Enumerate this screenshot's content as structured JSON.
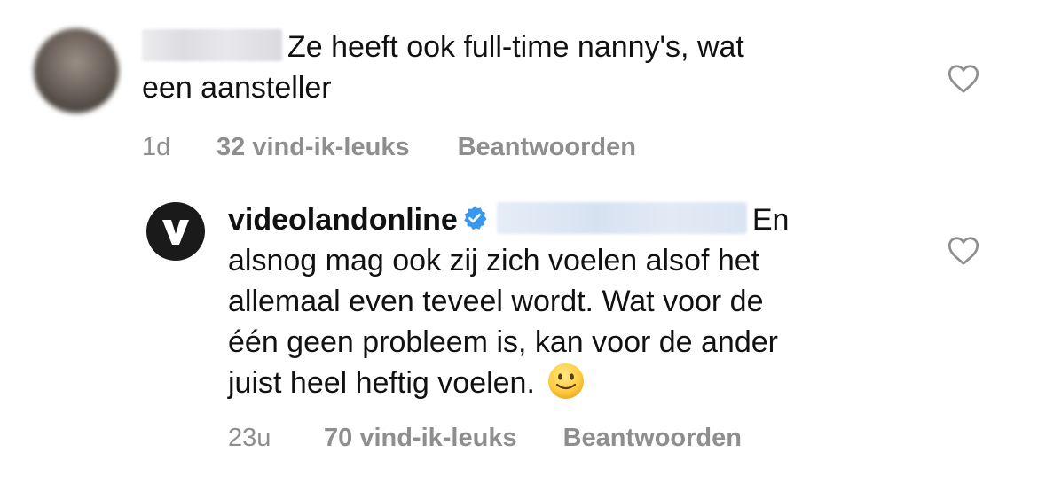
{
  "comments": [
    {
      "username": "",
      "text_line1": "Ze heeft ook full-time nanny's, wat",
      "text_line2": "een aansteller",
      "time": "1d",
      "likes": "32 vind-ik-leuks",
      "reply_label": "Beantwoorden"
    },
    {
      "username": "videolandonline",
      "mention": "",
      "text_line1": "En",
      "text_line2": "alsnog mag ook zij zich voelen alsof het",
      "text_line3": "allemaal even teveel wordt. Wat voor de",
      "text_line4": "één geen probleem is, kan voor de ander",
      "text_line5": "juist heel heftig voelen.",
      "time": "23u",
      "likes": "70 vind-ik-leuks",
      "reply_label": "Beantwoorden",
      "avatar_letter": "V",
      "verified": true
    }
  ],
  "icons": {
    "like": "heart-outline-icon",
    "verified": "verified-badge-icon",
    "emoji": "slightly-smiling-face-emoji"
  },
  "colors": {
    "text": "#111111",
    "meta": "#8e8e8e",
    "verified": "#3897f0",
    "avatar_bg": "#1a1a1a"
  }
}
